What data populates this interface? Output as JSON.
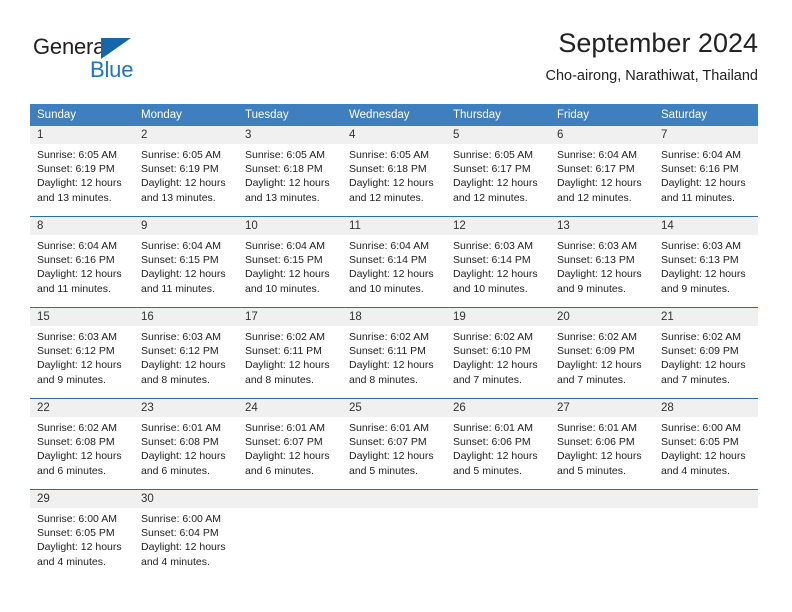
{
  "brand": {
    "name_part1": "General",
    "name_part2": "Blue",
    "triangle_color": "#1566ad",
    "blue_color": "#1d76c4"
  },
  "header": {
    "title": "September 2024",
    "subtitle": "Cho-airong, Narathiwat, Thailand"
  },
  "theme": {
    "header_blue": "#3d7fbf",
    "separator_blue": "#2e6da4",
    "daynum_band": "#f0f0f0"
  },
  "weekday_headers": [
    "Sunday",
    "Monday",
    "Tuesday",
    "Wednesday",
    "Thursday",
    "Friday",
    "Saturday"
  ],
  "weeks": [
    [
      {
        "day": "1",
        "sunrise": "Sunrise: 6:05 AM",
        "sunset": "Sunset: 6:19 PM",
        "daylight1": "Daylight: 12 hours",
        "daylight2": "and 13 minutes."
      },
      {
        "day": "2",
        "sunrise": "Sunrise: 6:05 AM",
        "sunset": "Sunset: 6:19 PM",
        "daylight1": "Daylight: 12 hours",
        "daylight2": "and 13 minutes."
      },
      {
        "day": "3",
        "sunrise": "Sunrise: 6:05 AM",
        "sunset": "Sunset: 6:18 PM",
        "daylight1": "Daylight: 12 hours",
        "daylight2": "and 13 minutes."
      },
      {
        "day": "4",
        "sunrise": "Sunrise: 6:05 AM",
        "sunset": "Sunset: 6:18 PM",
        "daylight1": "Daylight: 12 hours",
        "daylight2": "and 12 minutes."
      },
      {
        "day": "5",
        "sunrise": "Sunrise: 6:05 AM",
        "sunset": "Sunset: 6:17 PM",
        "daylight1": "Daylight: 12 hours",
        "daylight2": "and 12 minutes."
      },
      {
        "day": "6",
        "sunrise": "Sunrise: 6:04 AM",
        "sunset": "Sunset: 6:17 PM",
        "daylight1": "Daylight: 12 hours",
        "daylight2": "and 12 minutes."
      },
      {
        "day": "7",
        "sunrise": "Sunrise: 6:04 AM",
        "sunset": "Sunset: 6:16 PM",
        "daylight1": "Daylight: 12 hours",
        "daylight2": "and 11 minutes."
      }
    ],
    [
      {
        "day": "8",
        "sunrise": "Sunrise: 6:04 AM",
        "sunset": "Sunset: 6:16 PM",
        "daylight1": "Daylight: 12 hours",
        "daylight2": "and 11 minutes."
      },
      {
        "day": "9",
        "sunrise": "Sunrise: 6:04 AM",
        "sunset": "Sunset: 6:15 PM",
        "daylight1": "Daylight: 12 hours",
        "daylight2": "and 11 minutes."
      },
      {
        "day": "10",
        "sunrise": "Sunrise: 6:04 AM",
        "sunset": "Sunset: 6:15 PM",
        "daylight1": "Daylight: 12 hours",
        "daylight2": "and 10 minutes."
      },
      {
        "day": "11",
        "sunrise": "Sunrise: 6:04 AM",
        "sunset": "Sunset: 6:14 PM",
        "daylight1": "Daylight: 12 hours",
        "daylight2": "and 10 minutes."
      },
      {
        "day": "12",
        "sunrise": "Sunrise: 6:03 AM",
        "sunset": "Sunset: 6:14 PM",
        "daylight1": "Daylight: 12 hours",
        "daylight2": "and 10 minutes."
      },
      {
        "day": "13",
        "sunrise": "Sunrise: 6:03 AM",
        "sunset": "Sunset: 6:13 PM",
        "daylight1": "Daylight: 12 hours",
        "daylight2": "and 9 minutes."
      },
      {
        "day": "14",
        "sunrise": "Sunrise: 6:03 AM",
        "sunset": "Sunset: 6:13 PM",
        "daylight1": "Daylight: 12 hours",
        "daylight2": "and 9 minutes."
      }
    ],
    [
      {
        "day": "15",
        "sunrise": "Sunrise: 6:03 AM",
        "sunset": "Sunset: 6:12 PM",
        "daylight1": "Daylight: 12 hours",
        "daylight2": "and 9 minutes."
      },
      {
        "day": "16",
        "sunrise": "Sunrise: 6:03 AM",
        "sunset": "Sunset: 6:12 PM",
        "daylight1": "Daylight: 12 hours",
        "daylight2": "and 8 minutes."
      },
      {
        "day": "17",
        "sunrise": "Sunrise: 6:02 AM",
        "sunset": "Sunset: 6:11 PM",
        "daylight1": "Daylight: 12 hours",
        "daylight2": "and 8 minutes."
      },
      {
        "day": "18",
        "sunrise": "Sunrise: 6:02 AM",
        "sunset": "Sunset: 6:11 PM",
        "daylight1": "Daylight: 12 hours",
        "daylight2": "and 8 minutes."
      },
      {
        "day": "19",
        "sunrise": "Sunrise: 6:02 AM",
        "sunset": "Sunset: 6:10 PM",
        "daylight1": "Daylight: 12 hours",
        "daylight2": "and 7 minutes."
      },
      {
        "day": "20",
        "sunrise": "Sunrise: 6:02 AM",
        "sunset": "Sunset: 6:09 PM",
        "daylight1": "Daylight: 12 hours",
        "daylight2": "and 7 minutes."
      },
      {
        "day": "21",
        "sunrise": "Sunrise: 6:02 AM",
        "sunset": "Sunset: 6:09 PM",
        "daylight1": "Daylight: 12 hours",
        "daylight2": "and 7 minutes."
      }
    ],
    [
      {
        "day": "22",
        "sunrise": "Sunrise: 6:02 AM",
        "sunset": "Sunset: 6:08 PM",
        "daylight1": "Daylight: 12 hours",
        "daylight2": "and 6 minutes."
      },
      {
        "day": "23",
        "sunrise": "Sunrise: 6:01 AM",
        "sunset": "Sunset: 6:08 PM",
        "daylight1": "Daylight: 12 hours",
        "daylight2": "and 6 minutes."
      },
      {
        "day": "24",
        "sunrise": "Sunrise: 6:01 AM",
        "sunset": "Sunset: 6:07 PM",
        "daylight1": "Daylight: 12 hours",
        "daylight2": "and 6 minutes."
      },
      {
        "day": "25",
        "sunrise": "Sunrise: 6:01 AM",
        "sunset": "Sunset: 6:07 PM",
        "daylight1": "Daylight: 12 hours",
        "daylight2": "and 5 minutes."
      },
      {
        "day": "26",
        "sunrise": "Sunrise: 6:01 AM",
        "sunset": "Sunset: 6:06 PM",
        "daylight1": "Daylight: 12 hours",
        "daylight2": "and 5 minutes."
      },
      {
        "day": "27",
        "sunrise": "Sunrise: 6:01 AM",
        "sunset": "Sunset: 6:06 PM",
        "daylight1": "Daylight: 12 hours",
        "daylight2": "and 5 minutes."
      },
      {
        "day": "28",
        "sunrise": "Sunrise: 6:00 AM",
        "sunset": "Sunset: 6:05 PM",
        "daylight1": "Daylight: 12 hours",
        "daylight2": "and 4 minutes."
      }
    ],
    [
      {
        "day": "29",
        "sunrise": "Sunrise: 6:00 AM",
        "sunset": "Sunset: 6:05 PM",
        "daylight1": "Daylight: 12 hours",
        "daylight2": "and 4 minutes."
      },
      {
        "day": "30",
        "sunrise": "Sunrise: 6:00 AM",
        "sunset": "Sunset: 6:04 PM",
        "daylight1": "Daylight: 12 hours",
        "daylight2": "and 4 minutes."
      },
      {
        "day": "",
        "sunrise": "",
        "sunset": "",
        "daylight1": "",
        "daylight2": ""
      },
      {
        "day": "",
        "sunrise": "",
        "sunset": "",
        "daylight1": "",
        "daylight2": ""
      },
      {
        "day": "",
        "sunrise": "",
        "sunset": "",
        "daylight1": "",
        "daylight2": ""
      },
      {
        "day": "",
        "sunrise": "",
        "sunset": "",
        "daylight1": "",
        "daylight2": ""
      },
      {
        "day": "",
        "sunrise": "",
        "sunset": "",
        "daylight1": "",
        "daylight2": ""
      }
    ]
  ]
}
